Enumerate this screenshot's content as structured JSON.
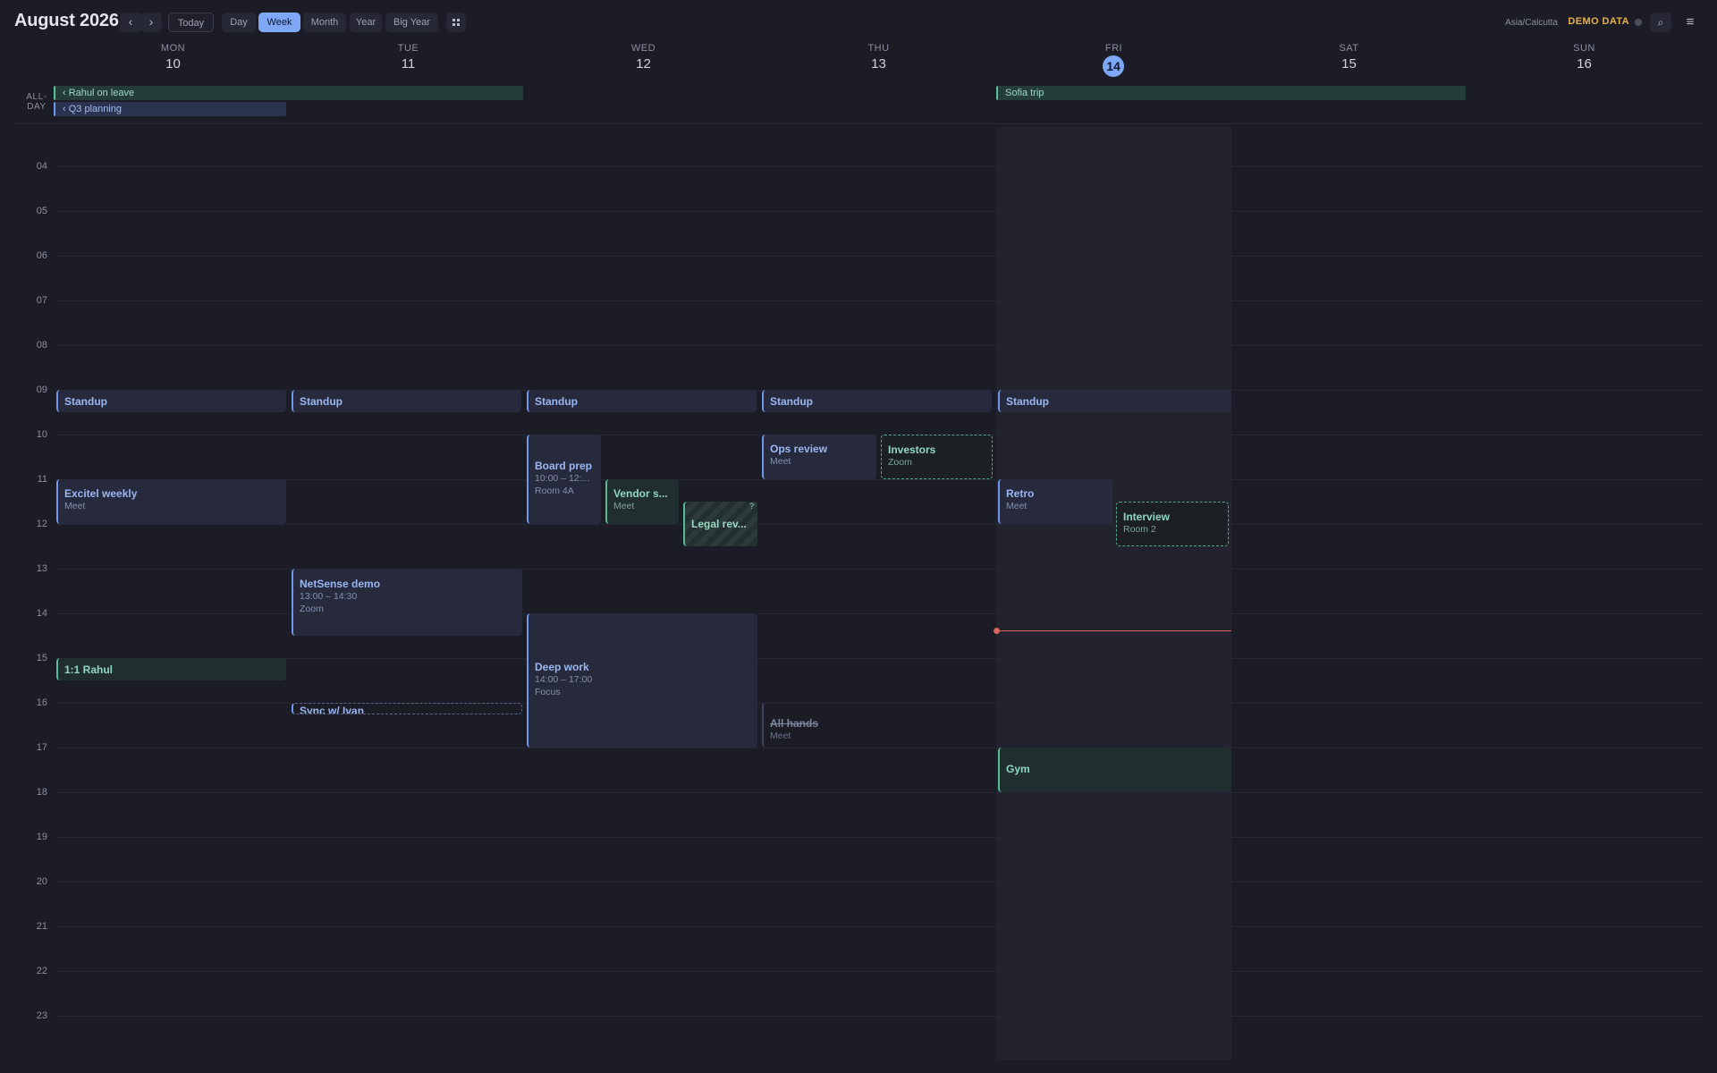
{
  "header": {
    "month": "August",
    "year": "2026",
    "nav_prev": "‹",
    "nav_next": "›",
    "today": "Today",
    "views": [
      "Day",
      "Week",
      "Month",
      "Year",
      "Big Year"
    ],
    "active_view": "Week",
    "grid_icon": "grid-icon",
    "timezone": "Asia/Calcutta",
    "demo_label": "DEMO DATA",
    "search_icon": "⌕",
    "menu_icon": "≡"
  },
  "days": [
    {
      "dow": "MON",
      "num": "10"
    },
    {
      "dow": "TUE",
      "num": "11"
    },
    {
      "dow": "WED",
      "num": "12"
    },
    {
      "dow": "THU",
      "num": "13"
    },
    {
      "dow": "FRI",
      "num": "14"
    },
    {
      "dow": "SAT",
      "num": "15"
    },
    {
      "dow": "SUN",
      "num": "16"
    }
  ],
  "allday": {
    "label": "ALL-DAY",
    "events": [
      {
        "title": "‹ Rahul on leave",
        "color": "#5bbf9c"
      },
      {
        "title": "‹ Q3 planning",
        "color": "#6f97ea"
      },
      {
        "title": "Sofia trip",
        "color": "#5bbf9c"
      }
    ]
  },
  "hours": [
    "04",
    "05",
    "06",
    "07",
    "08",
    "09",
    "10",
    "11",
    "12",
    "13",
    "14",
    "15",
    "16",
    "17",
    "18",
    "19",
    "20",
    "21",
    "22",
    "23"
  ],
  "events": {
    "standup_mon": {
      "title": "Standup"
    },
    "standup_tue": {
      "title": "Standup"
    },
    "standup_wed": {
      "title": "Standup"
    },
    "standup_thu": {
      "title": "Standup"
    },
    "standup_fri": {
      "title": "Standup"
    },
    "excitel": {
      "title": "Excitel weekly",
      "sub": "Meet"
    },
    "one_on_one": {
      "title": "1:1 Rahul"
    },
    "netsense": {
      "title": "NetSense demo",
      "time": "13:00 – 14:30",
      "sub": "Zoom"
    },
    "sync_ivan": {
      "title": "Sync w/ Ivan"
    },
    "board_prep": {
      "title": "Board prep",
      "time": "10:00 – 12:...",
      "sub": "Room 4A"
    },
    "vendor": {
      "title": "Vendor s...",
      "sub": "Meet"
    },
    "legal": {
      "title": "Legal rev...",
      "badge": "?"
    },
    "deep_work": {
      "title": "Deep work",
      "time": "14:00 – 17:00",
      "sub": "Focus"
    },
    "ops_review": {
      "title": "Ops review",
      "sub": "Meet"
    },
    "investors": {
      "title": "Investors",
      "sub": "Zoom"
    },
    "all_hands": {
      "title": "All hands",
      "sub": "Meet"
    },
    "retro": {
      "title": "Retro",
      "sub": "Meet"
    },
    "interview": {
      "title": "Interview",
      "sub": "Room 2"
    },
    "gym": {
      "title": "Gym"
    }
  },
  "colors": {
    "accent": "#7ea7f5",
    "green": "#56bc97",
    "now_line": "#d9655d",
    "demo": "#e8b14c"
  }
}
